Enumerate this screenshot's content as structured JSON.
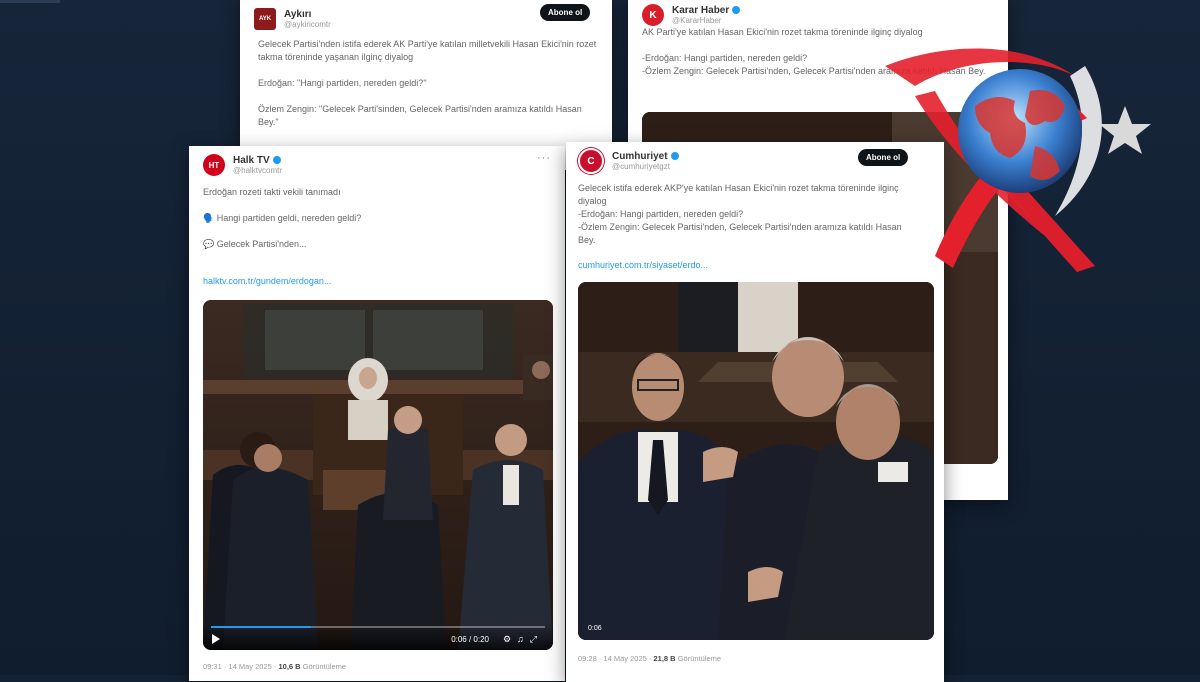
{
  "tweets": {
    "aykiri": {
      "name": "Aykırı",
      "handle": "@aykiricomtr",
      "follow": "Abone ol",
      "text": "Gelecek Partisi'nden istifa ederek AK Parti'ye katılan milletvekili Hasan Ekici'nin rozet takma töreninde yaşanan ilginç diyalog\n\nErdoğan: \"Hangi partiden, nereden geldi?\"\n\nÖzlem Zengin: \"Gelecek Parti'sinden, Gelecek Partisi'nden aramıza katıldı Hasan Bey.\""
    },
    "karar": {
      "name": "Karar Haber",
      "handle": "@KararHaber",
      "text": "AK Parti'ye katılan Hasan Ekici'nin rozet takma töreninde ilginç diyalog\n\n-Erdoğan: Hangi partiden, nereden geldi?\n-Özlem Zengin: Gelecek Partisi'nden, Gelecek Partisi'nden aramıza katıldı Hasan Bey."
    },
    "halk": {
      "name": "Halk TV",
      "handle": "@halktvcomtr",
      "text": "Erdoğan rozeti takti vekili tanımadı\n\n🗣️ Hangi partiden geldi, nereden geldi?\n\n💬 Gelecek Partisi'nden...",
      "link": "halktv.com.tr/gundem/erdogan...",
      "video_time": "0:06 / 0:20",
      "meta_time": "09:31 · 14 May 2025 ·",
      "views": "10,6 B",
      "views_label": "Görüntüleme"
    },
    "cumhuriyet": {
      "name": "Cumhuriyet",
      "handle": "@cumhuriyetgzt",
      "follow": "Abone ol",
      "text": "Gelecek istifa ederek AKP'ye katılan Hasan Ekici'nin rozet takma töreninde ilginç diyalog\n-Erdoğan: Hangi partiden, nereden geldi?\n-Özlem Zengin: Gelecek Partisi'nden, Gelecek Partisi'nden aramıza katıldı Hasan Bey.",
      "link": "cumhuriyet.com.tr/siyaset/erdo...",
      "video_badge": "0:06",
      "meta_time": "09:28 · 14 May 2025 ·",
      "views": "21,8 B",
      "views_label": "Görüntüleme"
    }
  },
  "icons": {
    "tweet_menu": "more-dots-icon",
    "play": "play-icon",
    "volume": "volume-icon",
    "fullscreen": "fullscreen-icon",
    "logo": "globe-crescent-star-logo"
  },
  "colors": {
    "background": "#142235",
    "verified": "#1d9bf0",
    "logo_red": "#e4202c",
    "logo_blue": "#3a7fd0",
    "karar_red": "#d81e2a",
    "cumhuriyet_red": "#c8102e",
    "halk_red": "#d0021b"
  }
}
